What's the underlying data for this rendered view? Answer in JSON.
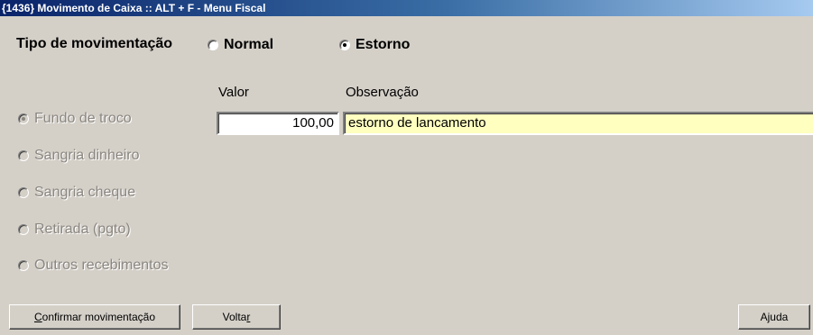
{
  "window": {
    "title": "{1436} Movimento de Caixa :: ALT + F - Menu Fiscal"
  },
  "tipo": {
    "label": "Tipo de movimentação",
    "options": [
      {
        "label": "Normal",
        "selected": false
      },
      {
        "label": "Estorno",
        "selected": true
      }
    ]
  },
  "columns": {
    "valor_label": "Valor",
    "observacao_label": "Observação"
  },
  "movimentos": [
    {
      "label": "Fundo de troco",
      "selected": true,
      "enabled": false
    },
    {
      "label": "Sangria dinheiro",
      "selected": false,
      "enabled": false
    },
    {
      "label": "Sangria cheque",
      "selected": false,
      "enabled": false
    },
    {
      "label": "Retirada (pgto)",
      "selected": false,
      "enabled": false
    },
    {
      "label": "Outros recebimentos",
      "selected": false,
      "enabled": false
    }
  ],
  "fields": {
    "valor": "100,00",
    "observacao": "estorno de lancamento"
  },
  "buttons": {
    "confirmar": {
      "pre": "",
      "accel": "C",
      "post": "onfirmar movimentação"
    },
    "voltar": {
      "pre": "Volta",
      "accel": "r",
      "post": ""
    },
    "ajuda": "Ajuda"
  },
  "colors": {
    "title_start": "#0a246a",
    "title_end": "#a6caf0",
    "face": "#d4d0c8",
    "obs_background": "#ffffc0"
  }
}
